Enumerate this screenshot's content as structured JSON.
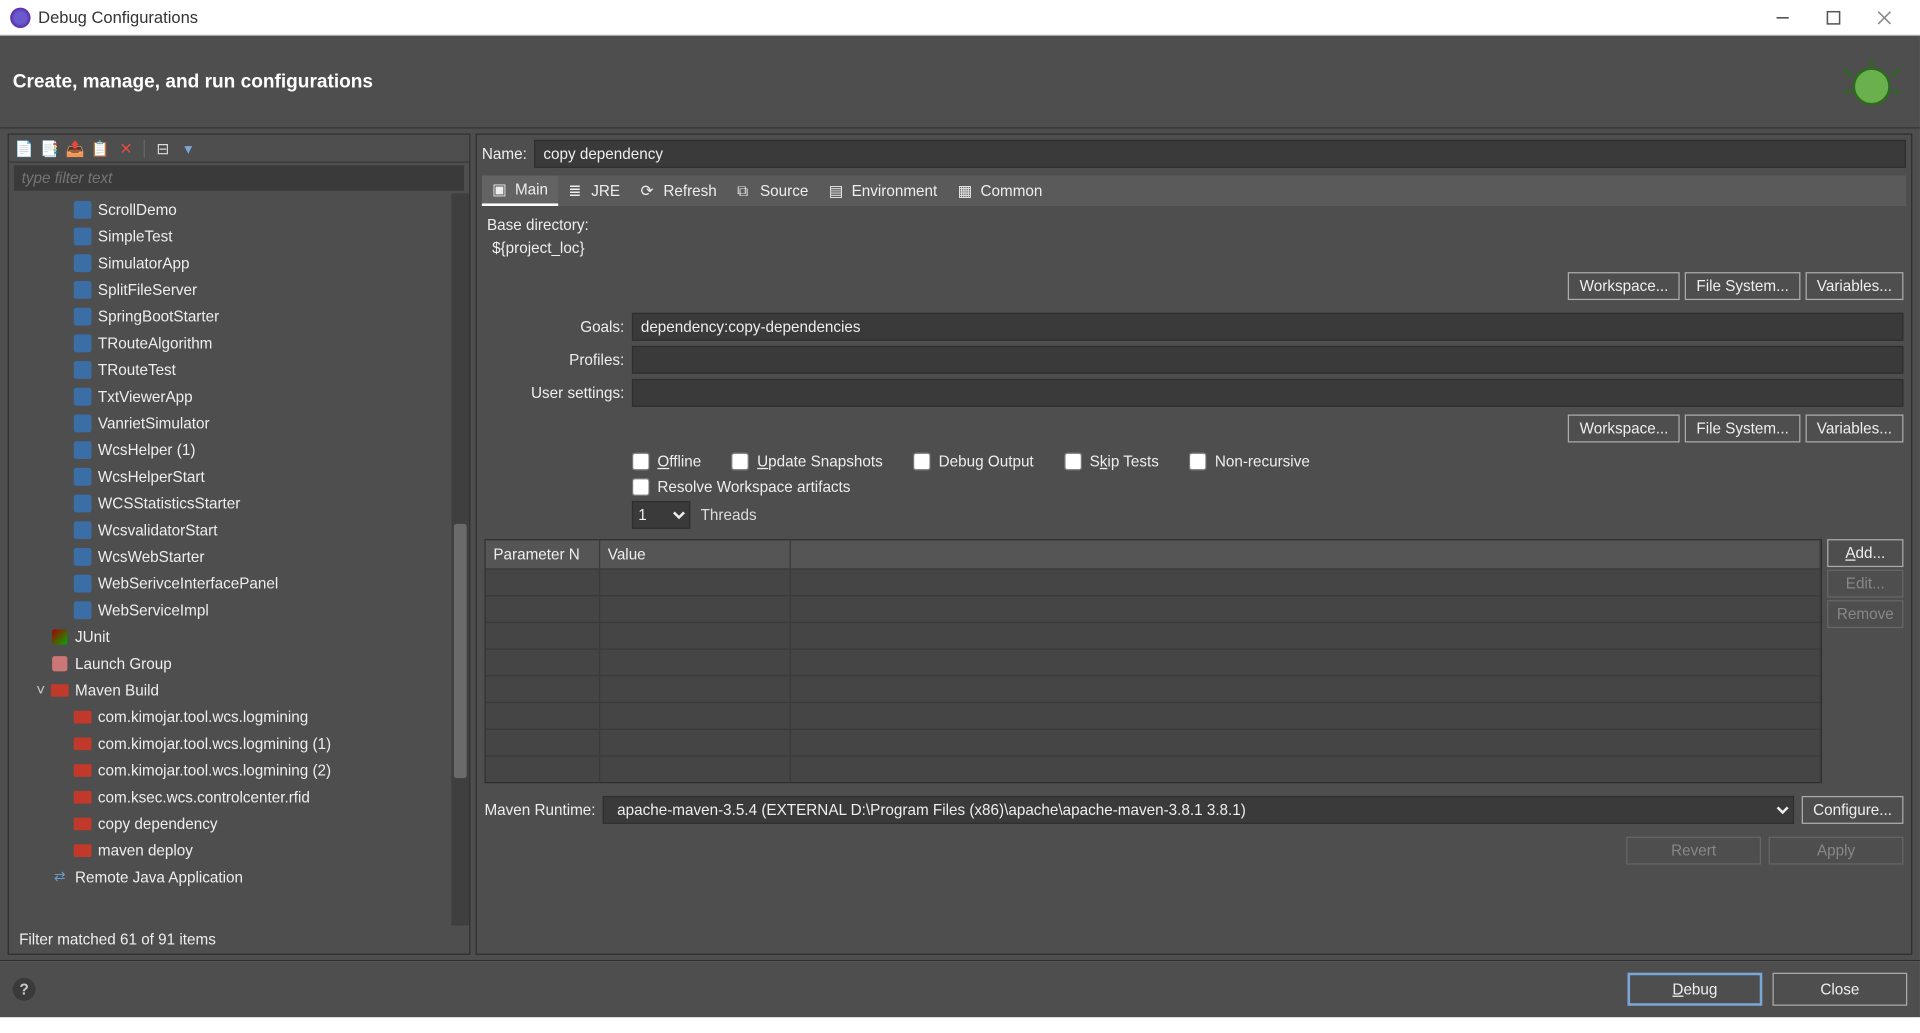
{
  "window": {
    "title": "Debug Configurations"
  },
  "header": {
    "title": "Create, manage, and run configurations"
  },
  "filter": {
    "placeholder": "type filter text"
  },
  "tree": [
    {
      "label": "ScrollDemo",
      "depth": 2,
      "icon": "j2"
    },
    {
      "label": "SimpleTest",
      "depth": 2,
      "icon": "j2"
    },
    {
      "label": "SimulatorApp",
      "depth": 2,
      "icon": "j2"
    },
    {
      "label": "SplitFileServer",
      "depth": 2,
      "icon": "j2"
    },
    {
      "label": "SpringBootStarter",
      "depth": 2,
      "icon": "j2"
    },
    {
      "label": "TRouteAlgorithm",
      "depth": 2,
      "icon": "j2"
    },
    {
      "label": "TRouteTest",
      "depth": 2,
      "icon": "j2"
    },
    {
      "label": "TxtViewerApp",
      "depth": 2,
      "icon": "j2"
    },
    {
      "label": "VanrietSimulator",
      "depth": 2,
      "icon": "j2"
    },
    {
      "label": "WcsHelper (1)",
      "depth": 2,
      "icon": "j2"
    },
    {
      "label": "WcsHelperStart",
      "depth": 2,
      "icon": "j2"
    },
    {
      "label": "WCSStatisticsStarter",
      "depth": 2,
      "icon": "j2"
    },
    {
      "label": "WcsvalidatorStart",
      "depth": 2,
      "icon": "j2"
    },
    {
      "label": "WcsWebStarter",
      "depth": 2,
      "icon": "j2"
    },
    {
      "label": "WebSerivceInterfacePanel",
      "depth": 2,
      "icon": "j2"
    },
    {
      "label": "WebServiceImpl",
      "depth": 2,
      "icon": "j2"
    },
    {
      "label": "JUnit",
      "depth": 1,
      "icon": "junit"
    },
    {
      "label": "Launch Group",
      "depth": 1,
      "icon": "launch"
    },
    {
      "label": "Maven Build",
      "depth": 1,
      "icon": "m2",
      "expanded": true
    },
    {
      "label": "com.kimojar.tool.wcs.logmining",
      "depth": 2,
      "icon": "m2"
    },
    {
      "label": "com.kimojar.tool.wcs.logmining (1)",
      "depth": 2,
      "icon": "m2"
    },
    {
      "label": "com.kimojar.tool.wcs.logmining (2)",
      "depth": 2,
      "icon": "m2"
    },
    {
      "label": "com.ksec.wcs.controlcenter.rfid",
      "depth": 2,
      "icon": "m2"
    },
    {
      "label": "copy dependency",
      "depth": 2,
      "icon": "m2"
    },
    {
      "label": "maven deploy",
      "depth": 2,
      "icon": "m2"
    },
    {
      "label": "Remote Java Application",
      "depth": 1,
      "icon": "remote"
    }
  ],
  "filtercount": "Filter matched 61 of 91 items",
  "right": {
    "name_label": "Name:",
    "name_value": "copy dependency",
    "tabs": [
      "Main",
      "JRE",
      "Refresh",
      "Source",
      "Environment",
      "Common"
    ],
    "basedir_label": "Base directory:",
    "basedir_value": "${project_loc}",
    "btn_workspace": "Workspace...",
    "btn_filesystem": "File System...",
    "btn_variables": "Variables...",
    "goals_label": "Goals:",
    "goals_value": "dependency:copy-dependencies",
    "profiles_label": "Profiles:",
    "profiles_value": "",
    "usersettings_label": "User settings:",
    "usersettings_value": "",
    "checks": {
      "offline": "Offline",
      "update": "Update Snapshots",
      "debugout": "Debug Output",
      "skiptests": "Skip Tests",
      "nonrecursive": "Non-recursive",
      "resolve": "Resolve Workspace artifacts"
    },
    "threads_label": "Threads",
    "threads_value": "1",
    "param_header": {
      "name": "Parameter N",
      "value": "Value"
    },
    "param_btns": {
      "add": "Add...",
      "edit": "Edit...",
      "remove": "Remove"
    },
    "runtime_label": "Maven Runtime:",
    "runtime_value": "apache-maven-3.5.4 (EXTERNAL D:\\Program Files (x86)\\apache\\apache-maven-3.8.1 3.8.1)",
    "btn_configure": "Configure...",
    "btn_revert": "Revert",
    "btn_apply": "Apply"
  },
  "footer": {
    "debug": "Debug",
    "close": "Close"
  }
}
